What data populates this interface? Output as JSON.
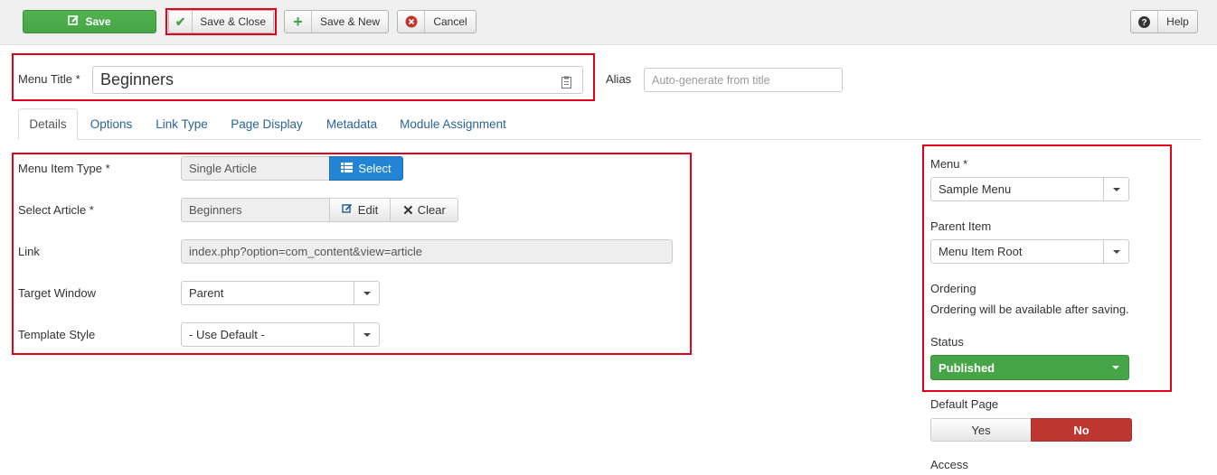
{
  "toolbar": {
    "save": "Save",
    "save_close": "Save & Close",
    "save_new": "Save & New",
    "cancel": "Cancel",
    "help": "Help"
  },
  "title": {
    "label": "Menu Title *",
    "value": "Beginners",
    "alias_label": "Alias",
    "alias_placeholder": "Auto-generate from title"
  },
  "tabs": [
    "Details",
    "Options",
    "Link Type",
    "Page Display",
    "Metadata",
    "Module Assignment"
  ],
  "details": {
    "menu_item_type": {
      "label": "Menu Item Type *",
      "value": "Single Article",
      "button": "Select"
    },
    "select_article": {
      "label": "Select Article *",
      "value": "Beginners",
      "edit": "Edit",
      "clear": "Clear"
    },
    "link": {
      "label": "Link",
      "value": "index.php?option=com_content&view=article"
    },
    "target_window": {
      "label": "Target Window",
      "value": "Parent"
    },
    "template_style": {
      "label": "Template Style",
      "value": "- Use Default -"
    }
  },
  "sidebar": {
    "menu": {
      "label": "Menu *",
      "value": "Sample Menu"
    },
    "parent_item": {
      "label": "Parent Item",
      "value": "Menu Item Root"
    },
    "ordering": {
      "label": "Ordering",
      "note": "Ordering will be available after saving."
    },
    "status": {
      "label": "Status",
      "value": "Published"
    },
    "default_page": {
      "label": "Default Page",
      "yes": "Yes",
      "no": "No"
    },
    "access": {
      "label": "Access"
    }
  },
  "colors": {
    "green": "#46a546",
    "blue": "#2384d3",
    "red": "#bd362f",
    "highlight": "#e3001b"
  }
}
